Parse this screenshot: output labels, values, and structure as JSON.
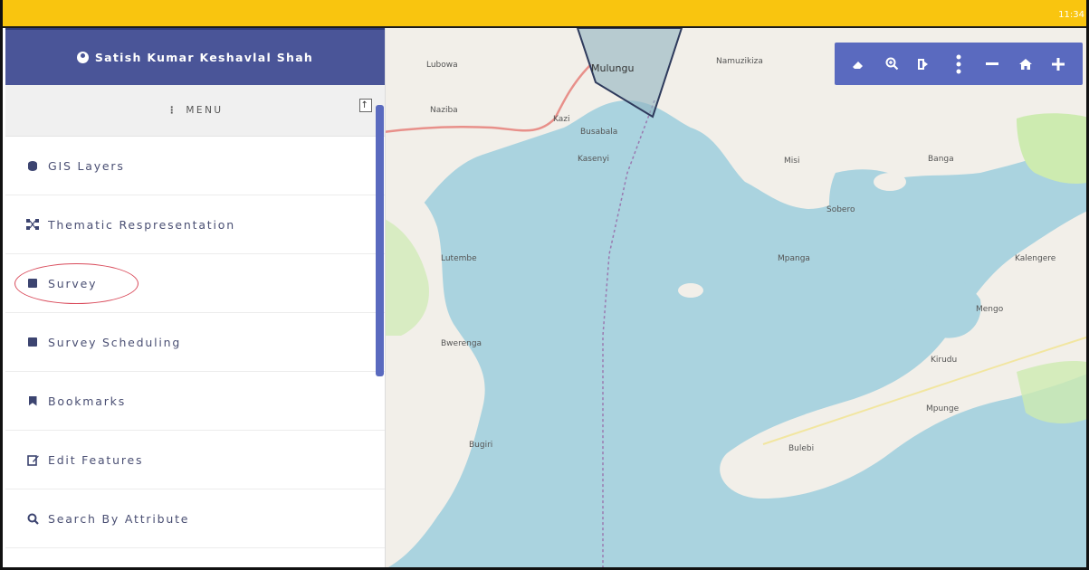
{
  "status_bar": {
    "time": "11:34"
  },
  "user": {
    "name": "Satish Kumar Keshavlal Shah"
  },
  "menu": {
    "title": "MENU",
    "items": [
      {
        "label": "GIS Layers",
        "icon": "database-icon"
      },
      {
        "label": "Thematic Respresentation",
        "icon": "nodes-icon"
      },
      {
        "label": "Survey",
        "icon": "square-icon",
        "highlighted": true
      },
      {
        "label": "Survey Scheduling",
        "icon": "square-icon"
      },
      {
        "label": "Bookmarks",
        "icon": "bookmark-icon"
      },
      {
        "label": "Edit Features",
        "icon": "edit-icon"
      },
      {
        "label": "Search By Attribute",
        "icon": "search-icon"
      }
    ]
  },
  "map": {
    "labels": [
      "Lubowa",
      "Mulungu",
      "Namuzikiza",
      "Naziba",
      "Kazi",
      "Busabala",
      "Kasenyi",
      "Misi",
      "Banga",
      "Sobero",
      "Lutembe",
      "Mpanga",
      "Kalengere",
      "Bwerenga",
      "Mengo",
      "Kirudu",
      "Mpunge",
      "Bulebi",
      "Bugiri"
    ],
    "toolbar": [
      "eraser-icon",
      "zoom-in-icon",
      "sign-out-icon",
      "more-vertical-icon",
      "minus-icon",
      "home-icon",
      "plus-icon"
    ]
  },
  "colors": {
    "status_bar": "#f9c50f",
    "header": "#4a5598",
    "accent": "#5a6abf",
    "water": "#aad3df",
    "land": "#f2efe9"
  }
}
